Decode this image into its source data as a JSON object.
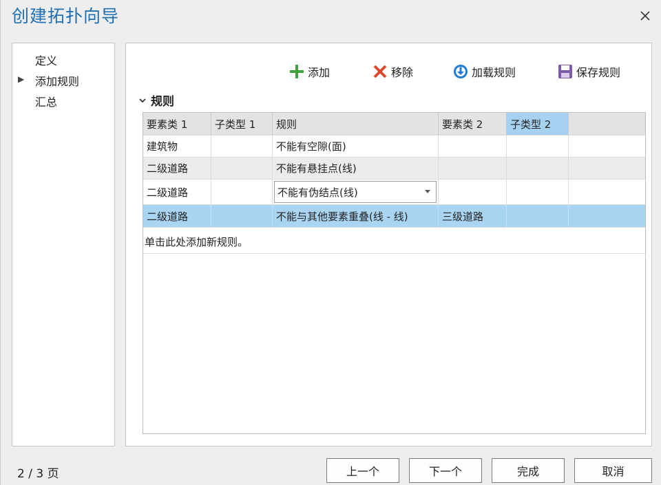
{
  "window": {
    "title": "创建拓扑向导"
  },
  "nav": {
    "items": [
      {
        "label": "定义",
        "current": false
      },
      {
        "label": "添加规则",
        "current": true
      },
      {
        "label": "汇总",
        "current": false
      }
    ]
  },
  "toolbar": {
    "add_label": "添加",
    "remove_label": "移除",
    "load_label": "加载规则",
    "save_label": "保存规则"
  },
  "section": {
    "title": "规则"
  },
  "table": {
    "columns": [
      "要素类 1",
      "子类型 1",
      "规则",
      "要素类 2",
      "子类型 2"
    ],
    "active_column": 4,
    "rows": [
      {
        "fc1": "建筑物",
        "st1": "",
        "rule": "不能有空隙(面)",
        "fc2": "",
        "st2": ""
      },
      {
        "fc1": "二级道路",
        "st1": "",
        "rule": "不能有悬挂点(线)",
        "fc2": "",
        "st2": ""
      },
      {
        "fc1": "二级道路",
        "st1": "",
        "rule": "不能有伪结点(线)",
        "fc2": "",
        "st2": ""
      },
      {
        "fc1": "二级道路",
        "st1": "",
        "rule": "不能与其他要素重叠(线 - 线)",
        "fc2": "三级道路",
        "st2": ""
      }
    ],
    "editing_row": 2,
    "selected_row": 3,
    "add_prompt": "单击此处添加新规则。"
  },
  "footer": {
    "page_indicator": "2 / 3 页",
    "back_label": "上一个",
    "next_label": "下一个",
    "finish_label": "完成",
    "cancel_label": "取消"
  },
  "colors": {
    "title_blue": "#1f6fb3",
    "add_green": "#3fa33f",
    "remove_red": "#d9472b",
    "load_blue": "#1e7bd1",
    "save_purple": "#7e5ba8",
    "selection": "#a9d5f3"
  },
  "icons": [
    "close-icon",
    "triangle-right-icon",
    "plus-icon",
    "cross-icon",
    "download-icon",
    "save-icon",
    "chevron-down-icon",
    "dropdown-arrow-icon"
  ]
}
